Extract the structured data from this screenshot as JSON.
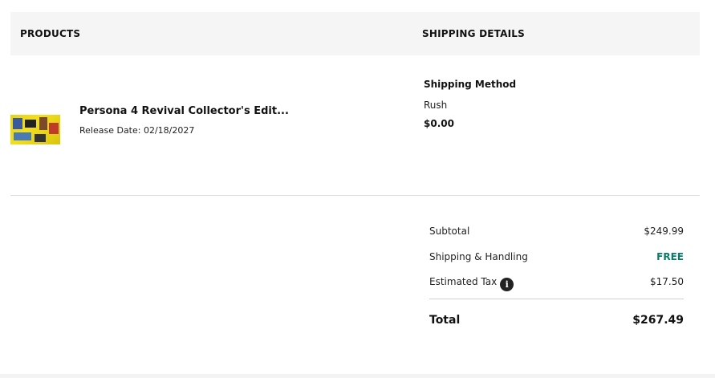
{
  "header": {
    "products_label": "PRODUCTS",
    "shipping_label": "SHIPPING DETAILS"
  },
  "product": {
    "title": "Persona 4 Revival Collector's Edit...",
    "release": "Release Date: 02/18/2027"
  },
  "shipping": {
    "method_label": "Shipping Method",
    "method_value": "Rush",
    "price": "$0.00"
  },
  "summary": {
    "subtotal_label": "Subtotal",
    "subtotal_value": "$249.99",
    "shipping_label": "Shipping & Handling",
    "shipping_value": "FREE",
    "tax_label": "Estimated Tax",
    "tax_icon": "i",
    "tax_value": "$17.50",
    "total_label": "Total",
    "total_value": "$267.49"
  },
  "colors": {
    "free_text": "#0a7a6a",
    "header_bg": "#f5f5f5"
  }
}
